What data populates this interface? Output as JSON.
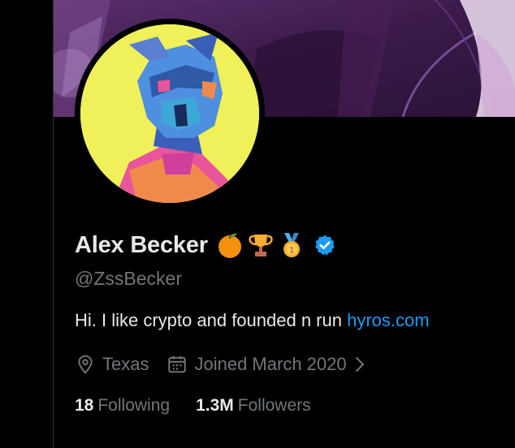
{
  "profile": {
    "display_name": "Alex Becker",
    "handle": "@ZssBecker",
    "badges": [
      "orange-icon",
      "trophy-icon",
      "medal-icon",
      "verified-badge-icon"
    ],
    "bio": {
      "text": "Hi. I like crypto and founded n run ",
      "link": "hyros.com"
    },
    "location": "Texas",
    "joined": "Joined March 2020",
    "stats": {
      "following_count": "18",
      "following_label": "Following",
      "followers_count": "1.3M",
      "followers_label": "Followers"
    }
  },
  "colors": {
    "background": "#000000",
    "text_primary": "#e7e9ea",
    "text_secondary": "#71767b",
    "link": "#1d9bf0",
    "verified": "#1d9bf0",
    "avatar_background": "#f0f05a"
  }
}
